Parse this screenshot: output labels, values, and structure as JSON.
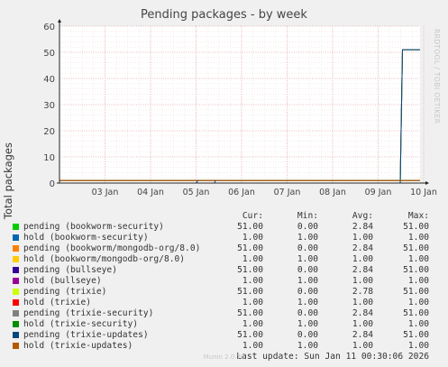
{
  "title": "Pending packages - by week",
  "side_text": "RRDTOOL / TOBI OETIKER",
  "footer": "Munin 2.0.76",
  "chart_data": {
    "type": "line",
    "title": "Pending packages - by week",
    "ylabel": "Total packages",
    "xlabel": "",
    "ylim": [
      0,
      60
    ],
    "yticks": [
      0,
      10,
      20,
      30,
      40,
      50,
      60
    ],
    "x_tick_labels": [
      "03 Jan",
      "04 Jan",
      "05 Jan",
      "06 Jan",
      "07 Jan",
      "08 Jan",
      "09 Jan",
      "10 Jan"
    ],
    "grid": true,
    "legend_position": "bottom",
    "legend_headers": [
      "Cur:",
      "Min:",
      "Avg:",
      "Max:"
    ],
    "series": [
      {
        "name": "pending (bookworm-security)",
        "color": "#00cc00",
        "cur": "51.00",
        "min": "0.00",
        "avg": "2.84",
        "max": "51.00"
      },
      {
        "name": "hold (bookworm-security)",
        "color": "#0066b3",
        "cur": "1.00",
        "min": "1.00",
        "avg": "1.00",
        "max": "1.00"
      },
      {
        "name": "pending (bookworm/mongodb-org/8.0)",
        "color": "#ff8000",
        "cur": "51.00",
        "min": "0.00",
        "avg": "2.84",
        "max": "51.00"
      },
      {
        "name": "hold (bookworm/mongodb-org/8.0)",
        "color": "#ffcc00",
        "cur": "1.00",
        "min": "1.00",
        "avg": "1.00",
        "max": "1.00"
      },
      {
        "name": "pending (bullseye)",
        "color": "#330099",
        "cur": "51.00",
        "min": "0.00",
        "avg": "2.84",
        "max": "51.00"
      },
      {
        "name": "hold (bullseye)",
        "color": "#990099",
        "cur": "1.00",
        "min": "1.00",
        "avg": "1.00",
        "max": "1.00"
      },
      {
        "name": "pending (trixie)",
        "color": "#ccff00",
        "cur": "51.00",
        "min": "0.00",
        "avg": "2.78",
        "max": "51.00"
      },
      {
        "name": "hold (trixie)",
        "color": "#ff0000",
        "cur": "1.00",
        "min": "1.00",
        "avg": "1.00",
        "max": "1.00"
      },
      {
        "name": "pending (trixie-security)",
        "color": "#808080",
        "cur": "51.00",
        "min": "0.00",
        "avg": "2.84",
        "max": "51.00"
      },
      {
        "name": "hold (trixie-security)",
        "color": "#008f00",
        "cur": "1.00",
        "min": "1.00",
        "avg": "1.00",
        "max": "1.00"
      },
      {
        "name": "pending (trixie-updates)",
        "color": "#00487d",
        "cur": "51.00",
        "min": "0.00",
        "avg": "2.84",
        "max": "51.00"
      },
      {
        "name": "hold (trixie-updates)",
        "color": "#b35a00",
        "cur": "1.00",
        "min": "1.00",
        "avg": "1.00",
        "max": "1.00"
      }
    ],
    "last_update": "Last update: Sun Jan 11 00:30:06 2026"
  }
}
